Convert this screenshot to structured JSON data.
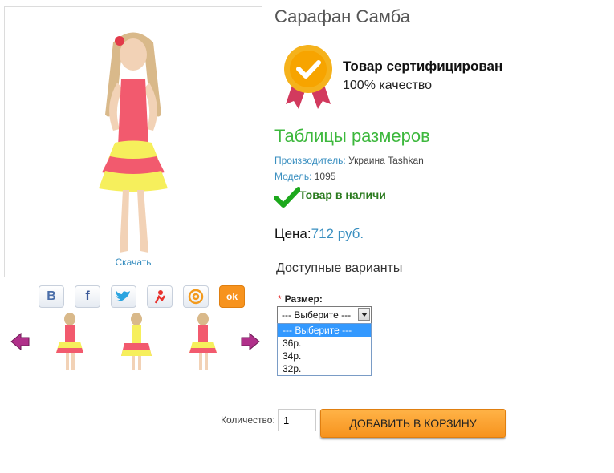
{
  "product": {
    "title": "Сарафан Самба",
    "download_label": "Скачать"
  },
  "certificate": {
    "title": "Товар сертифицирован",
    "subtitle": "100% качество"
  },
  "sizes_link": "Таблицы размеров",
  "meta": {
    "manufacturer_label": "Производитель:",
    "manufacturer_value": " Украина Tashkan",
    "model_label": "Модель:",
    "model_value": " 1095"
  },
  "stock": "Товар в наличи",
  "price": {
    "label": "Цена:",
    "value": "712 руб."
  },
  "options": {
    "title": "Доступные варианты",
    "size_required": "*",
    "size_label": "Размер:",
    "selected": "--- Выберите ---",
    "items": [
      "--- Выберите ---",
      "36р.",
      "34р.",
      "32р."
    ]
  },
  "social": {
    "vk": "В",
    "fb": "f",
    "ok": "ok"
  },
  "cart": {
    "qty_label": "Количество:",
    "qty_value": "1",
    "add_label": "ДОБАВИТЬ В КОРЗИНУ"
  },
  "colors": {
    "accent": "#3a8fc0",
    "green": "#3db83d",
    "button": "#f7931e"
  }
}
